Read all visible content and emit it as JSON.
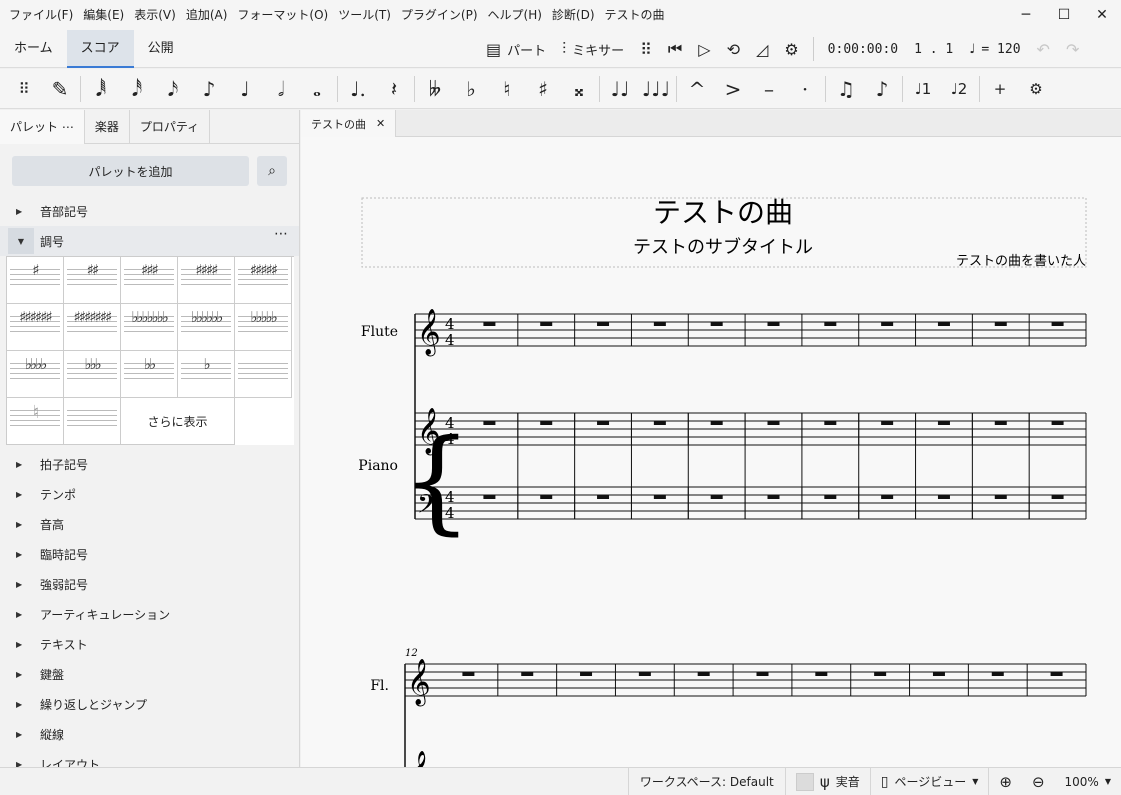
{
  "menubar": {
    "items": [
      "ファイル(F)",
      "編集(E)",
      "表示(V)",
      "追加(A)",
      "フォーマット(O)",
      "ツール(T)",
      "プラグイン(P)",
      "ヘルプ(H)",
      "診断(D)",
      "テストの曲"
    ],
    "controls": {
      "minimize": "─",
      "maximize": "☐",
      "close": "✕"
    }
  },
  "main_tabs": [
    "ホーム",
    "スコア",
    "公開"
  ],
  "toolbar": {
    "parts_label": "パート",
    "mixer_label": "ミキサー",
    "time": "0:00:00:0",
    "position": "1 . 1",
    "tempo": "= 120",
    "tempo_note": "♩"
  },
  "notebar": {
    "items": [
      "✎",
      "𝅘𝅥𝅱",
      "𝅘𝅥𝅰",
      "𝅘𝅥𝅯",
      "♪",
      "♩",
      "𝅗𝅥",
      "𝅝",
      "♩.",
      "𝄽",
      "𝄫",
      "♭",
      "♮",
      "♯",
      "𝄪",
      "♩♩",
      "♩♩♩",
      "^",
      ">",
      "–",
      "·",
      "♫",
      "♪",
      "♩1",
      "♩2",
      "+",
      "⚙"
    ]
  },
  "panel": {
    "tabs": [
      "パレット ⋯",
      "楽器",
      "プロパティ"
    ],
    "add_palette": "パレットを追加",
    "expanded": "調号",
    "more_label": "さらに表示",
    "groups_before": [
      "音部記号"
    ],
    "groups_after": [
      "拍子記号",
      "テンポ",
      "音高",
      "臨時記号",
      "強弱記号",
      "アーティキュレーション",
      "テキスト",
      "鍵盤",
      "繰り返しとジャンプ",
      "縦線",
      "レイアウト"
    ],
    "keysig_cells": [
      "♯",
      "♯♯",
      "♯♯♯",
      "♯♯♯♯",
      "♯♯♯♯♯",
      "♯♯♯♯♯♯",
      "♯♯♯♯♯♯♯",
      "♭♭♭♭♭♭♭",
      "♭♭♭♭♭♭",
      "♭♭♭♭♭",
      "♭♭♭♭",
      "♭♭♭",
      "♭♭",
      "♭",
      "",
      "♮",
      ""
    ]
  },
  "doc_tab": {
    "title": "テストの曲",
    "close": "✕"
  },
  "score": {
    "title": "テストの曲",
    "subtitle": "テストのサブタイトル",
    "composer": "テストの曲を書いた人",
    "flute_name": "Flute",
    "piano_name": "Piano",
    "flute_short": "Fl.",
    "measure_number": "12",
    "time_sig": "4"
  },
  "statusbar": {
    "workspace": "ワークスペース: Default",
    "concert_pitch": "実音",
    "view_mode": "ページビュー",
    "zoom": "100%"
  }
}
